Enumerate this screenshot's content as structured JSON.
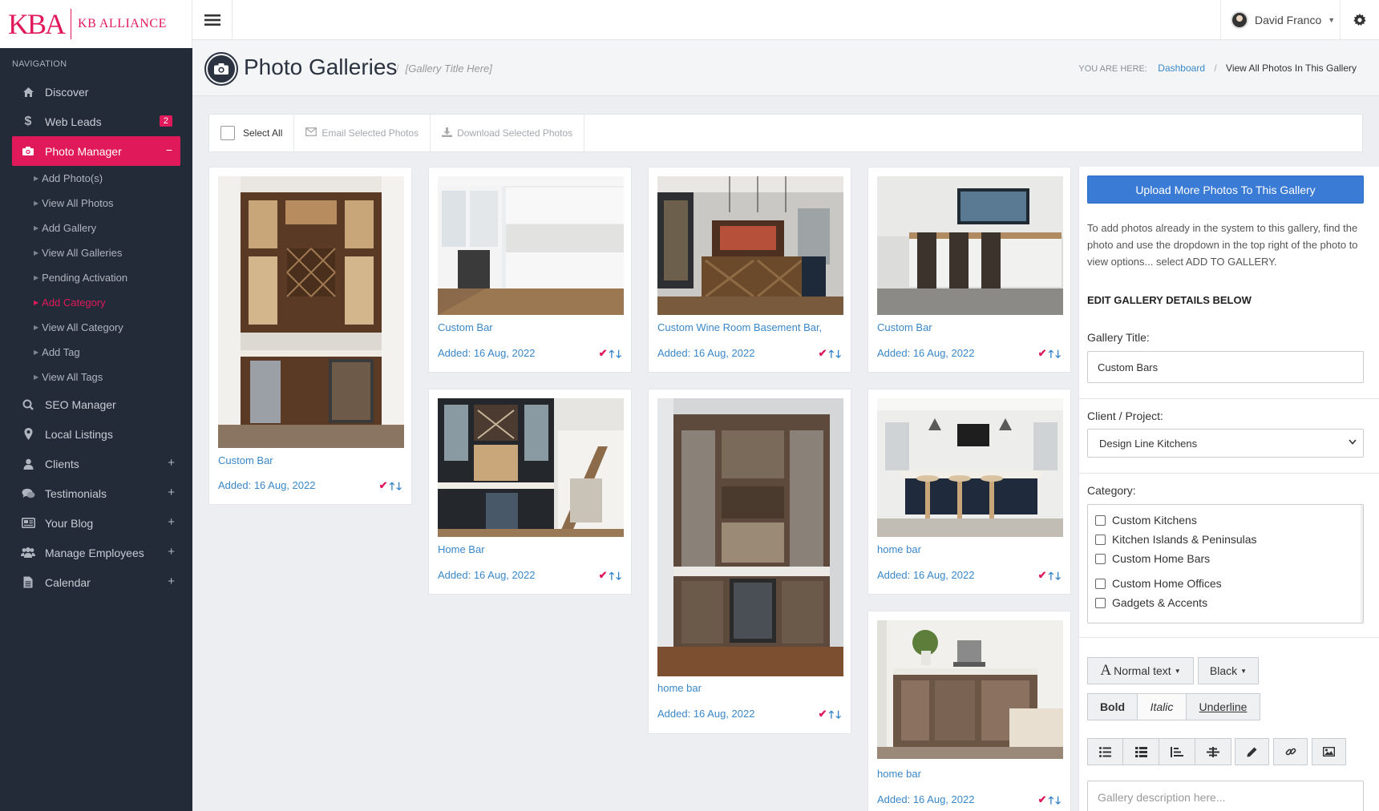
{
  "brand": {
    "logo_mark": "KBA",
    "logo_text": "KB ALLIANCE"
  },
  "sidebar": {
    "heading": "NAVIGATION",
    "items": [
      {
        "label": "Discover",
        "icon": "home-icon"
      },
      {
        "label": "Web Leads",
        "icon": "dollar-icon",
        "badge": "2"
      },
      {
        "label": "Photo Manager",
        "icon": "camera-icon",
        "active": true
      },
      {
        "label": "SEO Manager",
        "icon": "search-icon"
      },
      {
        "label": "Local Listings",
        "icon": "map-pin-icon"
      },
      {
        "label": "Clients",
        "icon": "user-icon",
        "expand": "+"
      },
      {
        "label": "Testimonials",
        "icon": "comments-icon",
        "expand": "+"
      },
      {
        "label": "Your Blog",
        "icon": "newspaper-icon",
        "expand": "+"
      },
      {
        "label": "Manage Employees",
        "icon": "users-icon",
        "expand": "+"
      },
      {
        "label": "Calendar",
        "icon": "file-icon",
        "expand": "+"
      }
    ],
    "photo_manager_sub": [
      "Add Photo(s)",
      "View All Photos",
      "Add Gallery",
      "View All Galleries",
      "Pending Activation",
      "Add Category",
      "View All Category",
      "Add Tag",
      "View All Tags"
    ],
    "collapse_symbol": "−"
  },
  "topbar": {
    "user_name": "David Franco"
  },
  "page": {
    "title": "Photo Galleries",
    "subtitle": "[Gallery Title Here]",
    "breadcrumb_label": "YOU ARE HERE:",
    "breadcrumb_link": "Dashboard",
    "breadcrumb_current": "View All Photos In This Gallery"
  },
  "toolbar": {
    "select_all": "Select All",
    "email": "Email Selected Photos",
    "download": "Download Selected Photos"
  },
  "photos": [
    {
      "caption": "Custom Bar",
      "date": "Added: 16 Aug, 2022"
    },
    {
      "caption": "Custom Bar",
      "date": "Added: 16 Aug, 2022"
    },
    {
      "caption": "Custom Wine Room Basement Bar,",
      "date": "Added: 16 Aug, 2022"
    },
    {
      "caption": "Custom Bar",
      "date": "Added: 16 Aug, 2022"
    },
    {
      "caption": "Home Bar",
      "date": "Added: 16 Aug, 2022"
    },
    {
      "caption": "home bar",
      "date": "Added: 16 Aug, 2022"
    },
    {
      "caption": "home bar",
      "date": "Added: 16 Aug, 2022"
    },
    {
      "caption": "home bar",
      "date": "Added: 16 Aug, 2022"
    }
  ],
  "panel": {
    "upload_button": "Upload More Photos To This Gallery",
    "help_text": "To add photos already in the system to this gallery, find the photo and use the dropdown in the top right of the photo to view options... select ADD TO GALLERY.",
    "edit_heading": "EDIT GALLERY DETAILS BELOW",
    "gallery_title_label": "Gallery Title:",
    "gallery_title_value": "Custom Bars",
    "client_label": "Client / Project:",
    "client_value": "Design Line Kitchens",
    "category_label": "Category:",
    "categories": [
      "Custom Kitchens",
      "Kitchen Islands & Peninsulas",
      "Custom Home Bars",
      "Custom Home Offices",
      "Gadgets & Accents"
    ],
    "font_button": "Normal text",
    "color_button": "Black",
    "bold": "Bold",
    "italic": "Italic",
    "underline": "Underline",
    "description_placeholder": "Gallery description here..."
  },
  "colors": {
    "accent": "#e0195a",
    "link": "#3a87c8",
    "sidebar": "#232b38",
    "primary_button": "#3a7bd5"
  }
}
